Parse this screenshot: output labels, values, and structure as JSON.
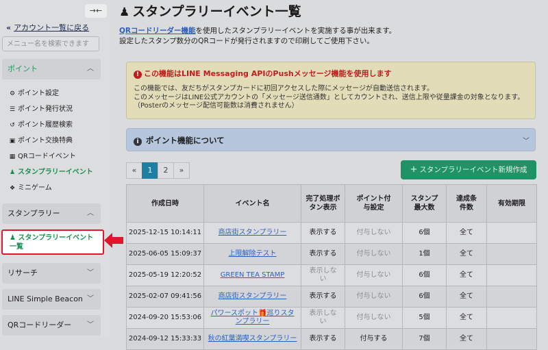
{
  "sidebar": {
    "collapse_label": "→←",
    "back_link": "アカウント一覧に戻る",
    "search_placeholder": "メニュー名を検索できます",
    "sections": {
      "point": "ポイント",
      "stamp": "スタンプラリー",
      "research": "リサーチ",
      "beacon": "LINE Simple Beacon",
      "qr": "QRコードリーダー"
    },
    "point_items": [
      {
        "label": "ポイント設定",
        "icon": "gear-icon"
      },
      {
        "label": "ポイント発行状況",
        "icon": "coins-icon"
      },
      {
        "label": "ポイント履歴検索",
        "icon": "history-icon"
      },
      {
        "label": "ポイント交換特典",
        "icon": "gift-icon"
      },
      {
        "label": "QRコードイベント",
        "icon": "qrcode-icon"
      },
      {
        "label": "スタンプラリーイベント",
        "icon": "stamp-icon"
      },
      {
        "label": "ミニゲーム",
        "icon": "game-icon"
      }
    ],
    "highlight_label": "スタンプラリーイベント一覧"
  },
  "main": {
    "title": "スタンプラリーイベント一覧",
    "intro_link": "QRコードリーダー機能",
    "intro_line1_rest": "を使用したスタンプラリーイベントを実施する事が出来ます。",
    "intro_line2": "設定したスタンプ数分のQRコードが発行されますので印刷してご使用下さい。",
    "warning": {
      "title": "この機能はLINE Messaging APIのPushメッセージ機能を使用します",
      "line1": "この機能では、友だちがスタンプカードに初回アクセスした際にメッセージが自動送信されます。",
      "line2": "このメッセージはLINE公式アカウントの「メッセージ送信通数」としてカウントされ、送信上限や従量課金の対象となります。",
      "line3": "（Posterのメッセージ配信可能数は消費されません）"
    },
    "accordion_title": "ポイント機能について",
    "pager": [
      "«",
      "1",
      "2",
      "»"
    ],
    "new_button": "スタンプラリーイベント新規作成",
    "table": {
      "headers": [
        "作成日時",
        "イベント名",
        "完了処理ボタン表示",
        "ポイント付与設定",
        "スタンプ最大数",
        "達成条件数",
        "有効期限"
      ],
      "rows": [
        {
          "date": "2025-12-15 10:14:11",
          "name": "商店街スタンプラリー",
          "button": "表示する",
          "point": "付与しない",
          "max": "6個",
          "cond": "全て",
          "expiry": ""
        },
        {
          "date": "2025-06-05 15:09:37",
          "name": "上限解除テスト",
          "button": "表示する",
          "point": "付与しない",
          "max": "1個",
          "cond": "全て",
          "expiry": ""
        },
        {
          "date": "2025-05-19 12:20:52",
          "name": "GREEN TEA STAMP",
          "button": "表示しない",
          "point": "付与しない",
          "max": "6個",
          "cond": "全て",
          "expiry": ""
        },
        {
          "date": "2025-02-07 09:41:56",
          "name": "商店街スタンプラリー",
          "button": "表示する",
          "point": "付与しない",
          "max": "6個",
          "cond": "全て",
          "expiry": ""
        },
        {
          "date": "2024-09-20 15:53:06",
          "name": "パワースポット🎁巡りスタンプラリー",
          "button": "表示しない",
          "point": "付与しない",
          "max": "5個",
          "cond": "全て",
          "expiry": ""
        },
        {
          "date": "2024-09-12 15:33:33",
          "name": "秋の紅葉満喫スタンプラリー",
          "button": "表示する",
          "point": "付与する",
          "max": "7個",
          "cond": "全て",
          "expiry": ""
        }
      ]
    }
  }
}
